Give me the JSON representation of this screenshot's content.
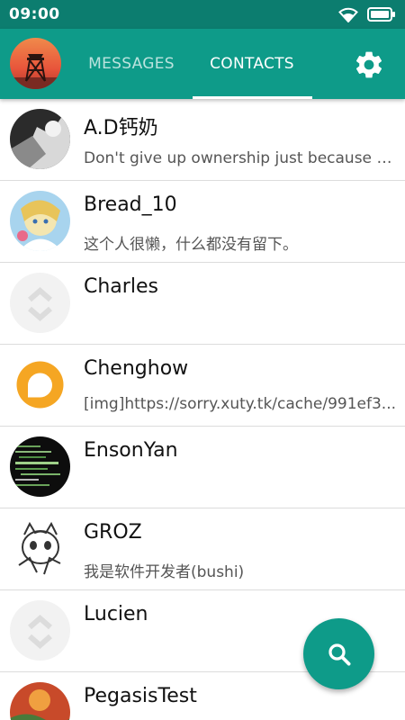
{
  "status_bar": {
    "time": "09:00"
  },
  "tabs": [
    {
      "label": "MESSAGES",
      "active": false
    },
    {
      "label": "CONTACTS",
      "active": true
    }
  ],
  "colors": {
    "primary": "#0e9b89",
    "status_bar": "#0c7d6f",
    "accent_orange": "#f5a623"
  },
  "contacts": [
    {
      "name": "A.D钙奶",
      "message": "Don't give up ownership just because you have to."
    },
    {
      "name": "Bread_10",
      "message": "这个人很懒，什么都没有留下。"
    },
    {
      "name": "Charles",
      "message": ""
    },
    {
      "name": "Chenghow",
      "message": "[img]https://sorry.xuty.tk/cache/991ef3..."
    },
    {
      "name": "EnsonYan",
      "message": ""
    },
    {
      "name": "GROZ",
      "message": "我是软件开发者(bushi)"
    },
    {
      "name": "Lucien",
      "message": ""
    },
    {
      "name": "PegasisTest",
      "message": ""
    }
  ],
  "icons": {
    "wifi": "wifi-icon",
    "battery": "battery-icon",
    "settings": "gear-icon",
    "search": "search-icon"
  }
}
